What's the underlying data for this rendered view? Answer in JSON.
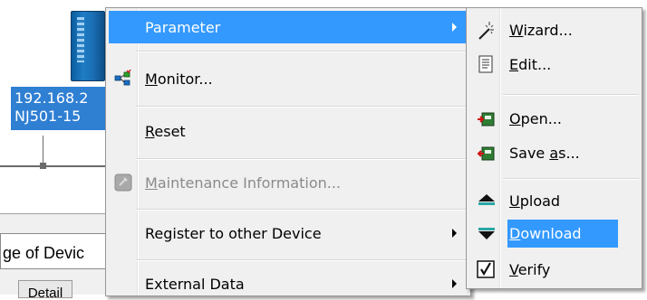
{
  "background": {
    "device_label_lines": [
      "192.168.2",
      "NJ501-15"
    ],
    "status_tab": "ge of Devic",
    "detail_tab": "Detail"
  },
  "menu": {
    "items": [
      {
        "label": "Parameter",
        "hotkey": "",
        "submenu": true,
        "highlighted": true,
        "disabled": false
      },
      {
        "label_pre": "",
        "hotkey": "M",
        "label_post": "onitor...",
        "icon": "monitor-icon"
      },
      {
        "label_pre": "",
        "hotkey": "R",
        "label_post": "eset"
      },
      {
        "label_pre": "",
        "hotkey": "M",
        "label_post": "aintenance Information...",
        "icon": "maintenance-icon",
        "disabled": true
      },
      {
        "label": "Register to other Device",
        "submenu": true
      },
      {
        "label": "External Data",
        "submenu": true
      }
    ]
  },
  "submenu": {
    "items": [
      {
        "label_pre": "",
        "hotkey": "W",
        "label_post": "izard...",
        "icon": "wizard-wand-icon"
      },
      {
        "label_pre": "",
        "hotkey": "E",
        "label_post": "dit...",
        "icon": "edit-document-icon"
      },
      {
        "label_pre": "",
        "hotkey": "O",
        "label_post": "pen...",
        "icon": "open-folder-icon"
      },
      {
        "label_pre": "Save ",
        "hotkey": "a",
        "label_post": "s...",
        "icon": "save-as-icon"
      },
      {
        "label_pre": "",
        "hotkey": "U",
        "label_post": "pload",
        "icon": "upload-icon"
      },
      {
        "label_pre": "",
        "hotkey": "D",
        "label_post": "ownload",
        "icon": "download-icon",
        "highlighted": true
      },
      {
        "label_pre": "",
        "hotkey": "V",
        "label_post": "erify",
        "icon": "verify-checkbox-icon"
      }
    ]
  },
  "colors": {
    "highlight": "#3399ff",
    "menu_bg": "#f0f0f0",
    "disabled_text": "#8a8a8a",
    "device_blue": "#2f7fd3"
  }
}
